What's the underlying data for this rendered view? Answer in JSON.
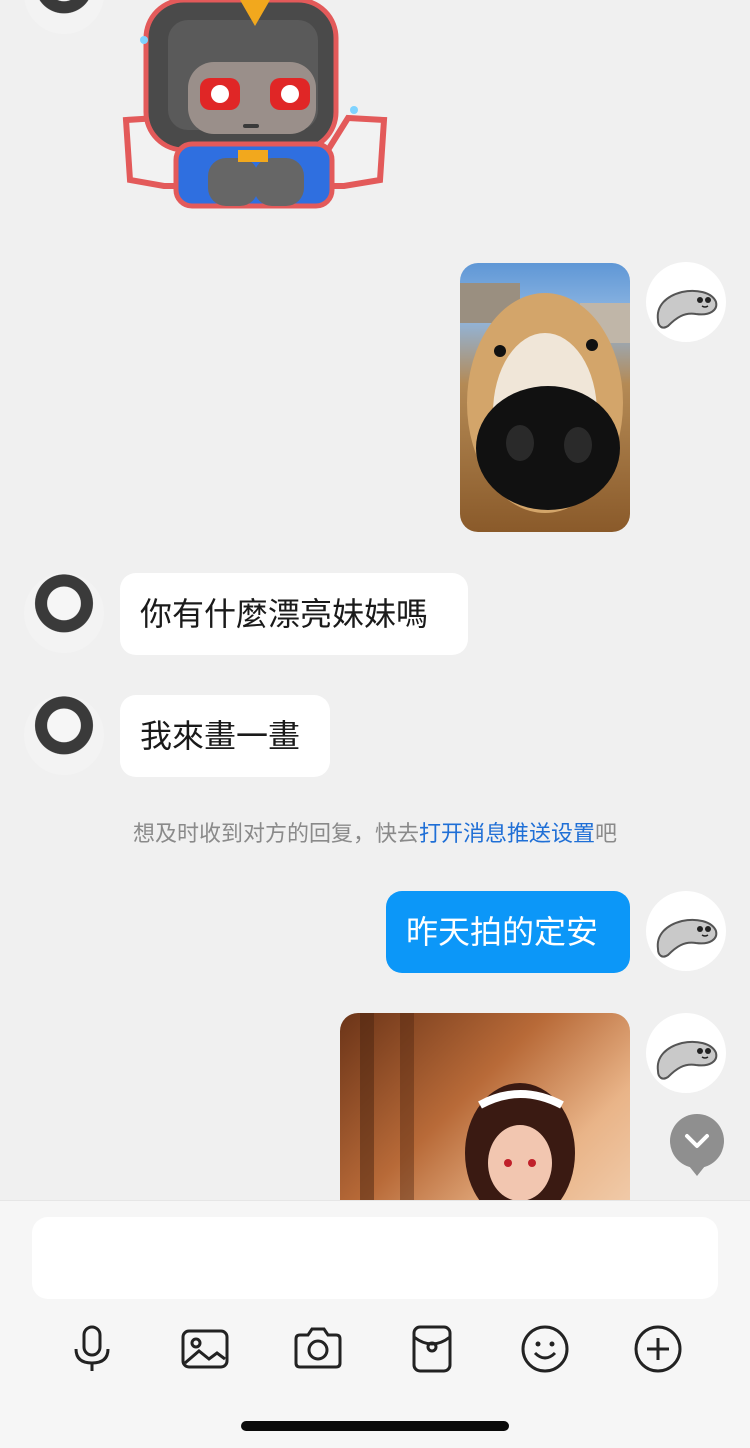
{
  "messages": [
    {
      "id": "m1",
      "side": "left",
      "type": "sticker",
      "sticker": "robot-sticker"
    },
    {
      "id": "m2",
      "side": "right",
      "type": "image",
      "image": "dog-photo"
    },
    {
      "id": "m3",
      "side": "left",
      "type": "text",
      "text": "你有什麼漂亮妹妹嗎"
    },
    {
      "id": "m4",
      "side": "left",
      "type": "text",
      "text": "我來畫一畫"
    },
    {
      "id": "m5",
      "side": "right",
      "type": "text",
      "text": "昨天拍的定安"
    },
    {
      "id": "m6",
      "side": "right",
      "type": "image",
      "image": "figure-photo"
    }
  ],
  "notice": {
    "prefix": "想及时收到对方的回复，快去",
    "link": "打开消息推送设置",
    "suffix": "吧"
  },
  "composer": {
    "placeholder": "",
    "tools": [
      "microphone-icon",
      "image-icon",
      "camera-icon",
      "red-packet-icon",
      "emoji-icon",
      "plus-icon"
    ]
  },
  "colors": {
    "outgoing_bubble": "#0c97f8",
    "incoming_bubble": "#ffffff",
    "background": "#f0f0f0",
    "link": "#1f6fd6"
  }
}
